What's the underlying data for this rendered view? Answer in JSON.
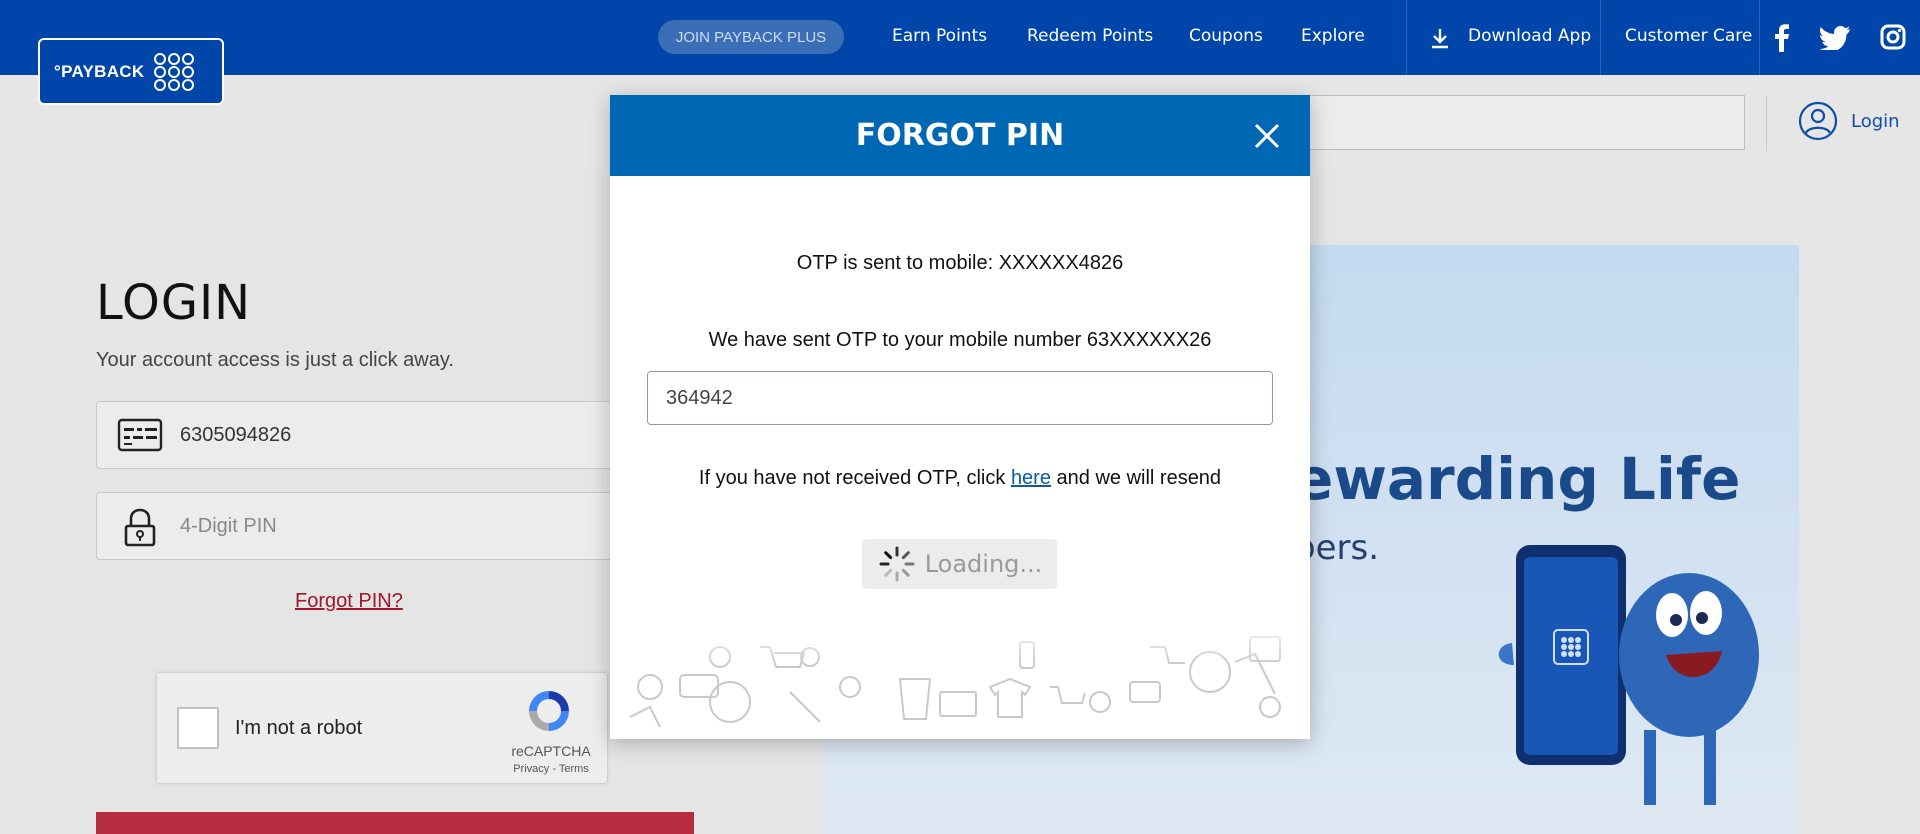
{
  "topnav": {
    "logo_text": "°PAYBACK",
    "join_plus": "JOIN PAYBACK PLUS",
    "links": [
      "Earn Points",
      "Redeem Points",
      "Coupons",
      "Explore"
    ],
    "download_app": "Download App",
    "customer_care": "Customer Care",
    "social_icons": [
      "facebook-icon",
      "twitter-icon",
      "instagram-icon"
    ]
  },
  "subbar": {
    "search_value": "",
    "login_label": "Login"
  },
  "login_form": {
    "title": "LOGIN",
    "subtitle": "Your account access is just a click away.",
    "card_number": "6305094826",
    "pin_placeholder": "4-Digit PIN",
    "forgot_link": "Forgot PIN?",
    "recaptcha": {
      "label": "I'm not a robot",
      "brand": "reCAPTCHA",
      "terms": "Privacy - Terms"
    }
  },
  "promo": {
    "headline_fragment": "ewarding Life",
    "sub_fragment": "bers."
  },
  "modal": {
    "title": "FORGOT PIN",
    "otp_sent_line": "OTP is sent to mobile: XXXXXX4826",
    "otp_info_line": "We have sent OTP to your mobile number 63XXXXXX26",
    "otp_value": "364942",
    "resend_prefix": "If you have not received OTP, click ",
    "resend_link": "here",
    "resend_suffix": " and we will resend",
    "loading_label": "Loading..."
  },
  "colors": {
    "brand_blue": "#0046aa",
    "modal_header": "#0067b4",
    "accent_red": "#a0172b"
  }
}
